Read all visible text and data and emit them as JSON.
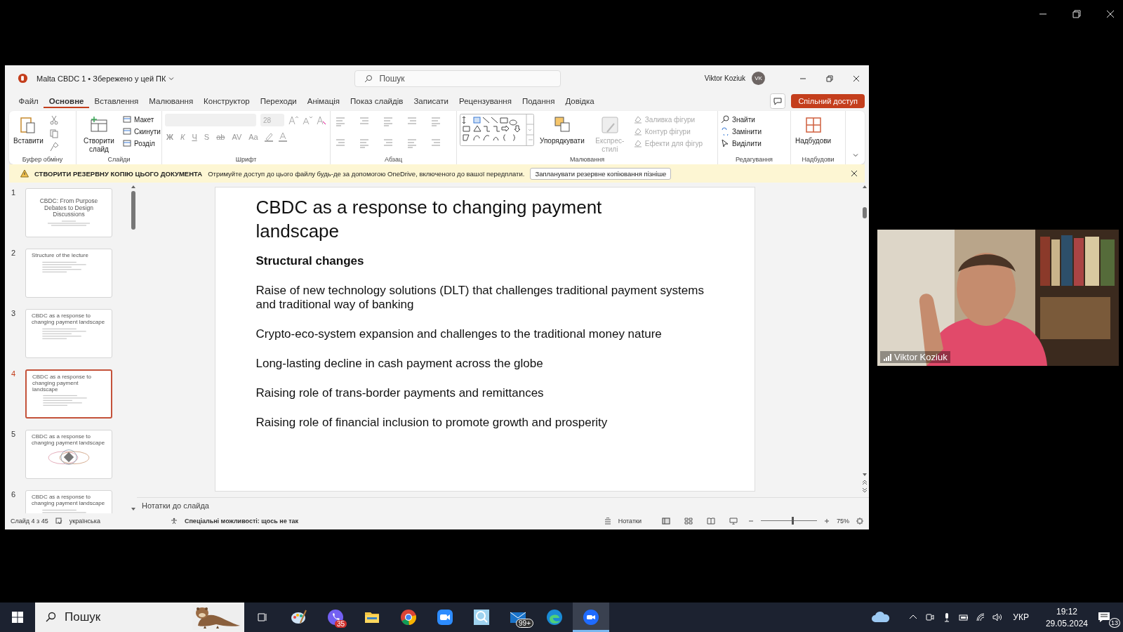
{
  "app": {
    "title": "Malta CBDC 1 • Збережено у цей ПК",
    "search_placeholder": "Пошук",
    "user": "Viktor Koziuk",
    "avatar": "VK"
  },
  "menu_tabs": [
    {
      "label": "Файл",
      "selected": false
    },
    {
      "label": "Основне",
      "selected": true
    },
    {
      "label": "Вставлення",
      "selected": false
    },
    {
      "label": "Малювання",
      "selected": false
    },
    {
      "label": "Конструктор",
      "selected": false
    },
    {
      "label": "Переходи",
      "selected": false
    },
    {
      "label": "Анімація",
      "selected": false
    },
    {
      "label": "Показ слайдів",
      "selected": false
    },
    {
      "label": "Записати",
      "selected": false
    },
    {
      "label": "Рецензування",
      "selected": false
    },
    {
      "label": "Подання",
      "selected": false
    },
    {
      "label": "Довідка",
      "selected": false
    }
  ],
  "share_button": "Спільний доступ",
  "ribbon": {
    "clipboard": {
      "label": "Буфер обміну",
      "paste": "Вставити"
    },
    "slides": {
      "label": "Слайди",
      "new_slide": "Створити слайд",
      "items": [
        "Макет",
        "Скинути",
        "Розділ"
      ]
    },
    "font": {
      "label": "Шрифт",
      "disabled": true,
      "size": "28",
      "buttons": [
        "Ж",
        "К",
        "Ч",
        "S",
        "ab",
        "AV",
        "Aa"
      ]
    },
    "paragraph": {
      "label": "Абзац"
    },
    "drawing": {
      "label": "Малювання",
      "arrange": "Упорядкувати",
      "quick_styles": {
        "label": "Експрес-стилі",
        "disabled": true
      },
      "items": [
        {
          "label": "Заливка фігури",
          "disabled": true
        },
        {
          "label": "Контур фігури",
          "disabled": true
        },
        {
          "label": "Ефекти для фігур",
          "disabled": true
        }
      ]
    },
    "editing": {
      "label": "Редагування",
      "items": [
        "Знайти",
        "Замінити",
        "Виділити"
      ]
    },
    "addins": {
      "label": "Надбудови",
      "button": "Надбудови"
    }
  },
  "message_bar": {
    "title": "СТВОРИТИ РЕЗЕРВНУ КОПІЮ ЦЬОГО ДОКУМЕНТА",
    "text": "Отримуйте доступ до цього файлу будь-де за допомогою OneDrive, включеного до вашої передплати.",
    "button": "Запланувати резервне копіювання пізніше"
  },
  "slides": [
    {
      "number": "1",
      "title": "CBDC: From Purpose Debates to Design Discussions",
      "kind": "title",
      "selected": false
    },
    {
      "number": "2",
      "title": "Structure of the lecture",
      "kind": "list",
      "selected": false
    },
    {
      "number": "3",
      "title": "CBDC as a response to changing payment landscape",
      "kind": "list",
      "selected": false
    },
    {
      "number": "4",
      "title": "CBDC as a response to changing payment landscape",
      "kind": "list",
      "selected": true
    },
    {
      "number": "5",
      "title": "CBDC as a response to changing payment landscape",
      "kind": "diagram",
      "selected": false
    },
    {
      "number": "6",
      "title": "CBDC as a response to changing payment landscape",
      "kind": "list",
      "selected": false
    }
  ],
  "current_slide": {
    "title": "CBDC as a response to changing payment landscape",
    "heading": "Structural changes",
    "bullets": [
      "Raise of new technology solutions (DLT) that challenges traditional payment systems and traditional way of banking",
      "Crypto-eco-system expansion and challenges to the traditional money nature",
      "Long-lasting decline in cash payment across the globe",
      "Raising role of trans-border payments and remittances",
      "Raising role of financial inclusion to promote growth and prosperity"
    ]
  },
  "notes_placeholder": "Нотатки до слайда",
  "status_bar": {
    "slide": "Слайд 4 з 45",
    "language": "українська",
    "accessibility": "Спеціальні можливості: щось не так",
    "notes": "Нотатки",
    "zoom": "75%",
    "zoom_slider": {
      "level": 0.55
    }
  },
  "video": {
    "name": "Viktor Koziuk"
  },
  "taskbar": {
    "search_placeholder": "Пошук",
    "apps": [
      {
        "kind": "paint",
        "selected": false
      },
      {
        "kind": "viber",
        "badge": "35",
        "selected": false
      },
      {
        "kind": "folder",
        "selected": false
      },
      {
        "kind": "chrome",
        "selected": false
      },
      {
        "kind": "camera",
        "selected": false
      },
      {
        "kind": "magnifier",
        "selected": false
      },
      {
        "kind": "mail",
        "badge": "99+",
        "selected": false
      },
      {
        "kind": "edge",
        "selected": false
      },
      {
        "kind": "zoom",
        "selected": true
      }
    ]
  },
  "tray": {
    "language": "УКР",
    "time": "19:12",
    "date": "29.05.2024",
    "notifications": "13"
  }
}
